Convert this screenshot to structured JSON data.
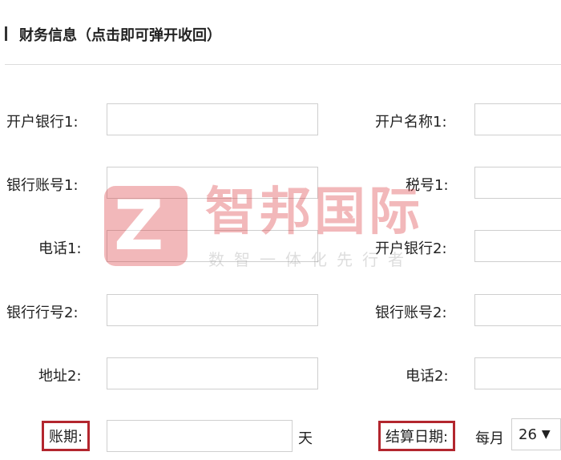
{
  "section": {
    "title": "财务信息（点击即可弹开收回）"
  },
  "left_fields": [
    {
      "label": "开户银行1:",
      "value": ""
    },
    {
      "label": "银行账号1:",
      "value": ""
    },
    {
      "label": "电话1:",
      "value": ""
    },
    {
      "label": "银行行号2:",
      "value": ""
    },
    {
      "label": "地址2:",
      "value": ""
    }
  ],
  "right_fields": [
    {
      "label": "开户名称1:",
      "value": ""
    },
    {
      "label": "税号1:",
      "value": ""
    },
    {
      "label": "开户银行2:",
      "value": ""
    },
    {
      "label": "银行账号2:",
      "value": ""
    },
    {
      "label": "电话2:",
      "value": ""
    }
  ],
  "account_period": {
    "label": "账期:",
    "value": "",
    "unit": "天"
  },
  "settlement_date": {
    "label": "结算日期:",
    "prefix": "每月",
    "selected": "26"
  },
  "watermark": {
    "logo_letter": "Z",
    "title": "智邦国际",
    "slogan": "数智一体化先行者"
  },
  "colors": {
    "highlight_border": "#b3262e",
    "watermark_red": "#d9262b"
  }
}
